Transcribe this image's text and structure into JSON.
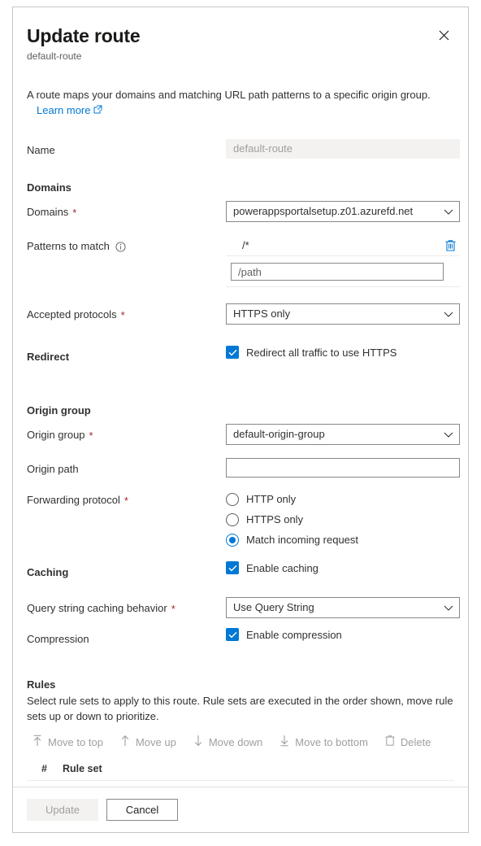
{
  "dialog": {
    "title": "Update route",
    "subtitle": "default-route",
    "close_icon": "close-icon",
    "intro_text": "A route maps your domains and matching URL path patterns to a specific origin group.",
    "learn_more_label": "Learn more",
    "learn_more_icon": "external-link-icon"
  },
  "name_field": {
    "label": "Name",
    "value": "default-route"
  },
  "domains_section": {
    "heading": "Domains",
    "domains_label": "Domains",
    "domains_required": "*",
    "domains_value": "powerappsportalsetup.z01.azurefd.net",
    "patterns_label": "Patterns to match",
    "patterns_info_icon": "info-icon",
    "patterns": [
      {
        "value": "/*",
        "delete_icon": "trash-icon"
      }
    ],
    "pattern_input_placeholder": "/path",
    "pattern_input_value": "",
    "accepted_protocols_label": "Accepted protocols",
    "accepted_protocols_required": "*",
    "accepted_protocols_value": "HTTPS only"
  },
  "redirect_section": {
    "heading": "Redirect",
    "checkbox_label": "Redirect all traffic to use HTTPS",
    "checkbox_checked": true
  },
  "origin_group_section": {
    "heading": "Origin group",
    "origin_group_label": "Origin group",
    "origin_group_required": "*",
    "origin_group_value": "default-origin-group",
    "origin_path_label": "Origin path",
    "origin_path_value": "",
    "forwarding_protocol_label": "Forwarding protocol",
    "forwarding_protocol_required": "*",
    "forwarding_options": [
      {
        "label": "HTTP only",
        "selected": false
      },
      {
        "label": "HTTPS only",
        "selected": false
      },
      {
        "label": "Match incoming request",
        "selected": true
      }
    ]
  },
  "caching_section": {
    "heading": "Caching",
    "enable_caching_label": "Enable caching",
    "enable_caching_checked": true,
    "query_string_label": "Query string caching behavior",
    "query_string_required": "*",
    "query_string_value": "Use Query String",
    "compression_label": "Compression",
    "enable_compression_label": "Enable compression",
    "enable_compression_checked": true
  },
  "rules_section": {
    "heading": "Rules",
    "description": "Select rule sets to apply to this route. Rule sets are executed in the order shown, move rule sets up or down to prioritize.",
    "commands": [
      {
        "label": "Move to top",
        "icon": "move-to-top-icon",
        "disabled": true
      },
      {
        "label": "Move up",
        "icon": "arrow-up-icon",
        "disabled": true
      },
      {
        "label": "Move down",
        "icon": "arrow-down-icon",
        "disabled": true
      },
      {
        "label": "Move to bottom",
        "icon": "move-to-bottom-icon",
        "disabled": true
      },
      {
        "label": "Delete",
        "icon": "trash-icon",
        "disabled": true
      }
    ],
    "table_headers": {
      "number": "#",
      "rule_set": "Rule set"
    },
    "rows": []
  },
  "footer": {
    "update_label": "Update",
    "update_disabled": true,
    "cancel_label": "Cancel"
  },
  "colors": {
    "accent": "#0078d4",
    "required": "#a4262c",
    "text": "#323130",
    "muted": "#605e5c",
    "disabled": "#a19f9d",
    "border": "#8a8886",
    "divider": "#edebe9",
    "readonly_bg": "#f3f2f1"
  }
}
